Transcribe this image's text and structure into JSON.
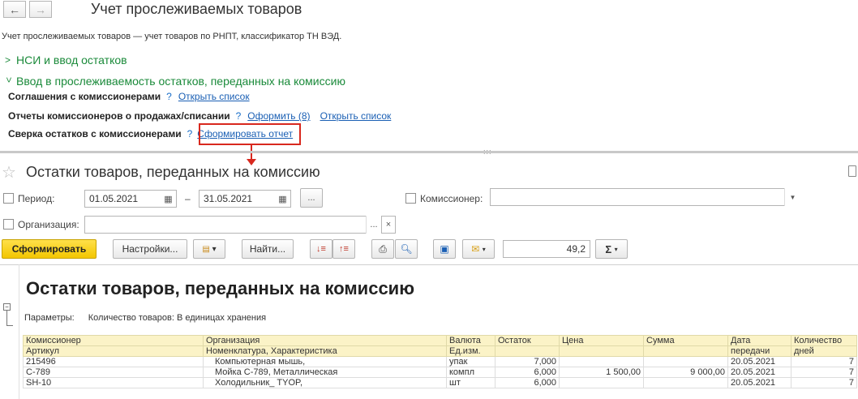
{
  "header": {
    "back_glyph": "←",
    "forward_glyph": "→",
    "title": "Учет прослеживаемых товаров",
    "description": "Учет прослеживаемых товаров — учет товаров по РНПТ, классификатор ТН ВЭД."
  },
  "groups": [
    {
      "label": "НСИ и ввод остатков",
      "expanded": false
    },
    {
      "label": "Ввод в прослеживаемость остатков, переданных на комиссию",
      "expanded": true
    }
  ],
  "section_rows": [
    {
      "label": "Соглашения с комиссионерами",
      "help": "?",
      "links": [
        "Открыть список"
      ]
    },
    {
      "label": "Отчеты комиссионеров о продажах/списании",
      "help": "?",
      "links": [
        "Оформить (8)",
        "Открыть список"
      ]
    },
    {
      "label": "Сверка остатков с комиссионерами",
      "help": "?",
      "links": [
        "Сформировать отчет"
      ]
    }
  ],
  "report_form": {
    "title": "Остатки товаров, переданных на комиссию",
    "period_label": "Период:",
    "date_from": "01.05.2021",
    "date_to": "31.05.2021",
    "dash": "–",
    "ellipsis": "...",
    "commissioner_label": "Комиссионер:",
    "organization_label": "Организация:",
    "clear_glyph": "×",
    "toolbar": {
      "generate": "Сформировать",
      "settings": "Настройки...",
      "find": "Найти...",
      "sum_value": "49,2",
      "sigma": "Σ"
    }
  },
  "report": {
    "title": "Остатки товаров, переданных на комиссию",
    "params_label": "Параметры:",
    "params_value": "Количество товаров: В единицах хранения",
    "headers_row1": [
      "Комиссионер",
      "Организация",
      "Валюта",
      "Остаток",
      "Цена",
      "Сумма",
      "Дата",
      "Количество"
    ],
    "headers_row2": [
      "Артикул",
      "Номенклатура, Характеристика",
      "Ед.изм.",
      "",
      "",
      "",
      "передачи",
      "дней"
    ],
    "rows": [
      {
        "article": "215496",
        "item": "Компьютерная мышь,",
        "unit": "упак",
        "qty": "7,000",
        "price": "",
        "sum": "",
        "date": "20.05.2021",
        "days": "7"
      },
      {
        "article": "С-789",
        "item": "Мойка С-789, Металлическая",
        "unit": "компл",
        "qty": "6,000",
        "price": "1 500,00",
        "sum": "9 000,00",
        "date": "20.05.2021",
        "days": "7"
      },
      {
        "article": "SH-10",
        "item": "Холодильник_ TYOP,",
        "unit": "шт",
        "qty": "6,000",
        "price": "",
        "sum": "",
        "date": "20.05.2021",
        "days": "7"
      }
    ]
  },
  "colors": {
    "accent_green": "#1a8a3a",
    "link_blue": "#1a5fb4",
    "highlight_red": "#d8281e",
    "primary_yellow": "#f3c600"
  }
}
